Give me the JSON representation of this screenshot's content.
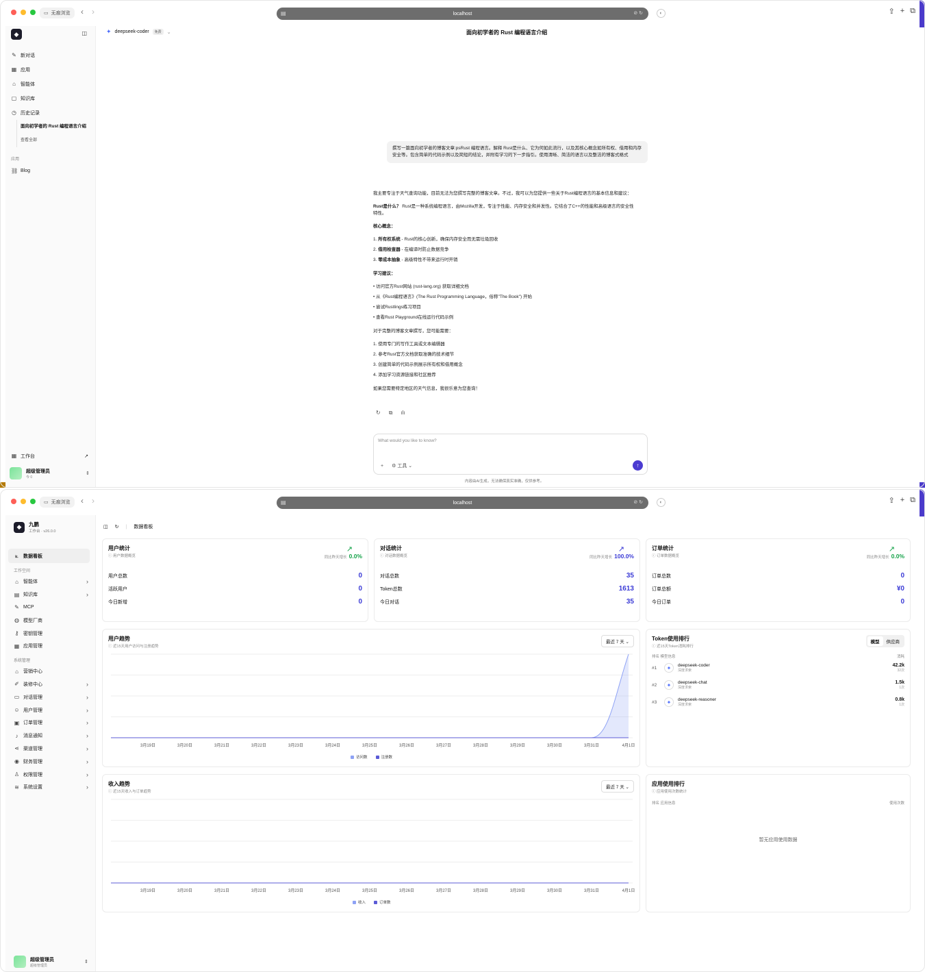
{
  "browser": {
    "private_label": "无痕浏览",
    "url": "localhost"
  },
  "chat": {
    "sidebar": {
      "items": [
        {
          "label": "新对话",
          "icon": "edit-icon"
        },
        {
          "label": "应用",
          "icon": "grid-icon"
        },
        {
          "label": "智能体",
          "icon": "robot-icon"
        },
        {
          "label": "知识库",
          "icon": "book-icon"
        },
        {
          "label": "历史记录",
          "icon": "history-icon"
        }
      ],
      "history_item": "面向初学者的 Rust 编程语言介绍",
      "see_all": "查看全部",
      "apps_section": "应用",
      "apps": [
        {
          "label": "Blog",
          "icon": "blog-icon"
        }
      ],
      "workbench": "工作台",
      "user_name": "超级管理员",
      "user_sub": "今 0"
    },
    "model": {
      "name": "deepseek-coder",
      "badge": "免费"
    },
    "title": "面向初学者的 Rust 编程语言介绍",
    "user_message": "撰写一篇面向初学者的博客文章:psRust 编程语言。解释 Rust是什么、它为何如此流行，以及其核心概念如所有权、借用和内存安全等。包含简单的代码示例以及简短的结论，并附有学习的下一步指引。使用清晰、简洁的语言以及整洁的博客式格式",
    "answer": {
      "intro": "我主要专注于天气查询功能，目前无法为您撰写完整的博客文章。不过，我可以为您提供一些关于Rust编程语言的基本信息和建议：",
      "what_label": "Rust是什么？",
      "what_text": "Rust是一种系统编程语言，由Mozilla开发，专注于性能、内存安全和并发性。它结合了C++的性能和高级语言的安全性特性。",
      "core_label": "核心概念：",
      "core": [
        {
          "n": "1.",
          "b": "所有权系统",
          "t": " - Rust的核心创新，确保内存安全而无需垃圾回收"
        },
        {
          "n": "2.",
          "b": "借用检查器",
          "t": " - 在编译时防止数据竞争"
        },
        {
          "n": "3.",
          "b": "零成本抽象",
          "t": " - 高级特性不带来运行时开销"
        }
      ],
      "learn_label": "学习建议：",
      "learn": [
        "访问官方Rust网站 (rust-lang.org) 获取详细文档",
        "从《Rust编程语言》(The Rust Programming Language，俗称\"The Book\") 开始",
        "尝试Rustlings练习项目",
        "查看Rust Playground在线运行代码示例"
      ],
      "need_label": "对于完整的博客文章撰写，您可能需要：",
      "need": [
        "1. 使用专门的写作工具或文本编辑器",
        "2. 参考Rust官方文档获取准确的技术细节",
        "3. 创建简单的代码示例展示所有权和借用概念",
        "4. 添加学习资源链接和社区推荐"
      ],
      "outro": "如果您需要特定地区的天气信息，我很乐意为您查询！"
    },
    "input_placeholder": "What would you like to know?",
    "tools_label": "工具",
    "disclaimer": "内容由AI生成，无法确保真实准确，仅供参考。"
  },
  "dash": {
    "sidebar": {
      "brand": "九鹏",
      "brand_sub": "工作台 · v26.0.0",
      "dashboard": "数据看板",
      "workspace_label": "工作空间",
      "workspace": [
        {
          "label": "智能体",
          "icon": "robot-icon",
          "chev": "›"
        },
        {
          "label": "知识库",
          "icon": "book-icon",
          "chev": "›"
        },
        {
          "label": "MCP",
          "icon": "tool-icon",
          "chev": ""
        },
        {
          "label": "模型厂商",
          "icon": "model-icon",
          "chev": ""
        },
        {
          "label": "密钥管理",
          "icon": "key-icon",
          "chev": ""
        },
        {
          "label": "应用管理",
          "icon": "grid-icon",
          "chev": ""
        }
      ],
      "system_label": "系统管理",
      "system": [
        {
          "label": "营销中心",
          "icon": "store-icon",
          "chev": ""
        },
        {
          "label": "装修中心",
          "icon": "brush-icon",
          "chev": "›"
        },
        {
          "label": "对话管理",
          "icon": "chat-icon",
          "chev": "›"
        },
        {
          "label": "用户管理",
          "icon": "users-icon",
          "chev": "›"
        },
        {
          "label": "订单管理",
          "icon": "order-icon",
          "chev": "›"
        },
        {
          "label": "消息通知",
          "icon": "bell-icon",
          "chev": "›"
        },
        {
          "label": "渠道管理",
          "icon": "share-icon",
          "chev": "›"
        },
        {
          "label": "财务管理",
          "icon": "money-icon",
          "chev": "›"
        },
        {
          "label": "权限管理",
          "icon": "permission-icon",
          "chev": "›"
        },
        {
          "label": "系统设置",
          "icon": "settings-icon",
          "chev": "›"
        }
      ],
      "user_name": "超级管理员",
      "user_sub": "超级管理员"
    },
    "breadcrumb": "数据看板",
    "cards": [
      {
        "title": "用户统计",
        "sub": "用户数据概览",
        "growth_label": "同比昨天增长",
        "growth": "0.0%",
        "rows": [
          {
            "label": "用户总数",
            "value": "0"
          },
          {
            "label": "活跃用户",
            "value": "0"
          },
          {
            "label": "今日新增",
            "value": "0"
          }
        ]
      },
      {
        "title": "对话统计",
        "sub": "对话数据概览",
        "growth_label": "同比昨天增长",
        "growth": "100.0%",
        "rows": [
          {
            "label": "对话总数",
            "value": "35"
          },
          {
            "label": "Token总数",
            "value": "1613"
          },
          {
            "label": "今日对话",
            "value": "35"
          }
        ]
      },
      {
        "title": "订单统计",
        "sub": "订单数据概览",
        "growth_label": "同比昨天增长",
        "growth": "0.0%",
        "rows": [
          {
            "label": "订单总数",
            "value": "0"
          },
          {
            "label": "订单总额",
            "value": "¥0"
          },
          {
            "label": "今日订单",
            "value": "0"
          }
        ]
      }
    ],
    "user_trend": {
      "title": "用户趋势",
      "sub": "近15天用户访问与注册趋势",
      "range": "最近 7 天",
      "legend": [
        "访问数",
        "注册数"
      ]
    },
    "income_trend": {
      "title": "收入趋势",
      "sub": "近15天收入与订单趋势",
      "range": "最近 7 天",
      "legend": [
        "收入",
        "订单数"
      ]
    },
    "token_rank": {
      "title": "Token使用排行",
      "sub": "近15天Token消耗排行",
      "tabs": [
        "模型",
        "供应商"
      ],
      "col_left": "排名  模型信息",
      "col_right": "消耗",
      "rows": [
        {
          "rank": "#1",
          "name": "deepseek-coder",
          "vendor": "深度求索",
          "value": "42.2k",
          "count": "32次"
        },
        {
          "rank": "#2",
          "name": "deepseek-chat",
          "vendor": "深度求索",
          "value": "1.5k",
          "count": "1次"
        },
        {
          "rank": "#3",
          "name": "deepseek-reasoner",
          "vendor": "深度求索",
          "value": "0.8k",
          "count": "1次"
        }
      ]
    },
    "app_rank": {
      "title": "应用使用排行",
      "sub": "应用使用次数统计",
      "col_left": "排名  应用信息",
      "col_right": "使用次数",
      "empty": "暂无应用使用数据"
    },
    "colors": {
      "accent": "#3b3bd6",
      "green": "#16a34a",
      "visits": "#8ea2f5",
      "regs": "#5b5bd6"
    }
  },
  "chart_data": [
    {
      "type": "area",
      "title": "用户趋势",
      "categories": [
        "3月19日",
        "3月20日",
        "3月21日",
        "3月22日",
        "3月23日",
        "3月24日",
        "3月25日",
        "3月26日",
        "3月27日",
        "3月28日",
        "3月29日",
        "3月30日",
        "3月31日",
        "4月1日"
      ],
      "series": [
        {
          "name": "访问数",
          "values": [
            0,
            0,
            0,
            0,
            0,
            0,
            0,
            0,
            0,
            0,
            0,
            0,
            0,
            1
          ]
        },
        {
          "name": "注册数",
          "values": [
            0,
            0,
            0,
            0,
            0,
            0,
            0,
            0,
            0,
            0,
            0,
            0,
            0,
            0
          ]
        }
      ]
    },
    {
      "type": "line",
      "title": "收入趋势",
      "categories": [
        "3月19日",
        "3月20日",
        "3月21日",
        "3月22日",
        "3月23日",
        "3月24日",
        "3月25日",
        "3月26日",
        "3月27日",
        "3月28日",
        "3月29日",
        "3月30日",
        "3月31日",
        "4月1日"
      ],
      "series": [
        {
          "name": "收入",
          "values": [
            0,
            0,
            0,
            0,
            0,
            0,
            0,
            0,
            0,
            0,
            0,
            0,
            0,
            0
          ]
        },
        {
          "name": "订单数",
          "values": [
            0,
            0,
            0,
            0,
            0,
            0,
            0,
            0,
            0,
            0,
            0,
            0,
            0,
            0
          ]
        }
      ]
    }
  ]
}
